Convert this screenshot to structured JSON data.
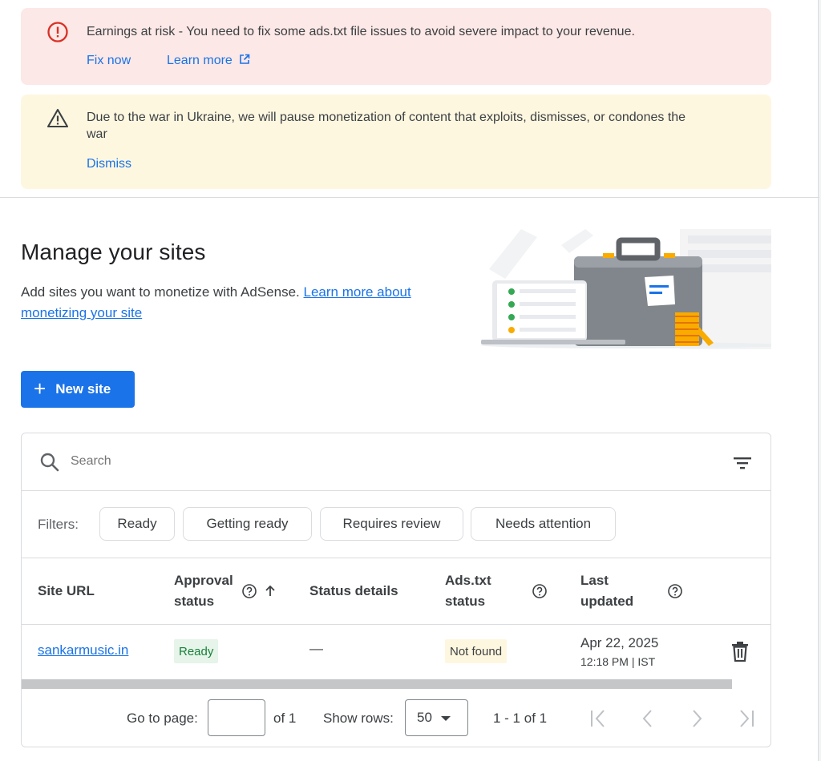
{
  "alerts": {
    "error": {
      "icon": "error-circle-icon",
      "message": "Earnings at risk - You need to fix some ads.txt file issues to avoid severe impact to your revenue.",
      "fix_label": "Fix now",
      "learn_label": "Learn more",
      "color": "#fce8e6"
    },
    "warning": {
      "icon": "warning-triangle-icon",
      "message_line1": "Due to the war in Ukraine, we will pause monetization of content that exploits, dismisses, or condones the",
      "message_line2": "war",
      "dismiss_label": "Dismiss",
      "color": "#fef7e0"
    }
  },
  "header": {
    "title": "Manage your sites",
    "description": "Add sites you want to monetize with AdSense.",
    "link_line1": "Learn more about",
    "link_line2": "monetizing your site"
  },
  "actions": {
    "new_site_plus": "+",
    "new_site_label": "New site",
    "accent": "#1a73e8"
  },
  "table": {
    "search_placeholder": "Search",
    "filters_label": "Filters:",
    "filter_chips": [
      "Ready",
      "Getting ready",
      "Requires review",
      "Needs attention"
    ],
    "columns": {
      "site_url": "Site URL",
      "approval_line1": "Approval",
      "approval_line2": "status",
      "status_details": "Status details",
      "ads_line1": "Ads.txt",
      "ads_line2": "status",
      "updated_line1": "Last",
      "updated_line2": "updated"
    },
    "rows": [
      {
        "site": "sankarmusic.in",
        "approval": "Ready",
        "details": "—",
        "ads_txt": "Not found",
        "updated_date": "Apr 22, 2025",
        "updated_time": "12:18 PM | IST"
      }
    ],
    "status_colors": {
      "ready_bg": "#e6f4ea",
      "ready_fg": "#188038",
      "notfound_bg": "#fef7e0"
    }
  },
  "pagination": {
    "go_to_label": "Go to page:",
    "page_value": "",
    "of_label": "of 1",
    "show_rows_label": "Show rows:",
    "rows_value": "50",
    "range": "1 - 1 of 1"
  }
}
